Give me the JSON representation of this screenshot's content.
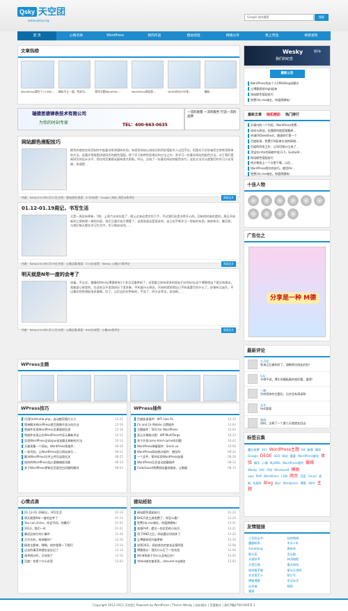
{
  "site": {
    "logo_a": "Qsky",
    "logo_b": "天空团",
    "url": "www.qsky.org"
  },
  "search": {
    "placeholder": "Google 站内搜索",
    "button": "搜索"
  },
  "nav": [
    "首 页",
    "心情点滴",
    "WordPress",
    "我的作品",
    "建站经验",
    "网络分享",
    "我上传品",
    "探索发现"
  ],
  "hot": {
    "title": "文章热榜",
    "items": [
      "WordPress简约个人CMS/...",
      "精彩不止一面，色彩为...",
      "简约主题WordPres...",
      "WordPress网站首...",
      "DEDE的SEO分享...",
      "最新...",
      "反对30天，只做...",
      "WordPress采集..."
    ]
  },
  "ad_top": {
    "company": "瑞德思德律表技术有限公司",
    "slogan": "为你的时刻专家",
    "phone": "TEL：400-663-0635",
    "right": "一流的质量 一流的服务 打造一流的品牌"
  },
  "posts": [
    {
      "title": "网站颜色搭配技巧",
      "text": "颜色的使用在网页制作中起着非常关键的作用，有很多网站以其成功的色彩搭配令人过目不忘。但是对于初学者而言常常用简单的方法，这篇文章就是讲述网页的颜色搭配。除了学习各种色彩理论和方法之外，多学习一些著名网站的配色方法，对于我们提高网页的设计水平，抓住网页美感无疑有很大帮助。所以，总结了一些著名网站的配色技巧，这些方法可以使我们的学习少走弯路，快速提...",
      "meta": "作者：Tokky/2013年1月22日/分类：建站经验/阅读：47次/标签：Google, 网站, 网页/6条评论",
      "more": "阅读全文"
    },
    {
      "title": "01.12-01.19周记，书写生活",
      "text": "又是一周没有更新，Y朋，上周六去年吃饭了，晚上过来还是交到下手，不过我们还是非常开心的。回来的时候也是的，周日开始新的三周和第一周的内容，然后又要开始写博客了，这周里面还是挺多的，自己也不断学习一些新的东西，新的知识，最后呢，与我们每天都在学习生活中，学习和成长吧。...",
      "meta": "作者：Tokky/2013年1月19日/分类：心情点滴/阅读：215次/标签：Wesky, 心情/37条评论",
      "more": "阅读全文"
    },
    {
      "title": "明天就是N年一度的会考了",
      "text": "听着，不过这，慢慢的Wesky博客就有1个多月没看更新了，还是跟之前有很多的朋友们对Wesky这个博客提出了意见和建议，我都虚心接受的，在这些日子里我经历了很多事，不知道什么原因，开始的就觉得自己不知道要写些什么了，好像有点迷茫。不过最近经常想起很多事情，好了，以后会好好更新的，不说了，明天去考试，加油吧。...",
      "meta": "作者：Tokky/2013年1月11日/分类：心情点滴/阅读：690次/标签：心情/84条评论",
      "more": "阅读全文"
    }
  ],
  "wp_themes": {
    "title": "WPress主题"
  },
  "wp_tips": {
    "title": "WPress技巧",
    "items": [
      [
        "巧用timthumb.php，自动裁剪图片大小",
        "12-21"
      ],
      [
        "简单解决WordPress首页图像不显示的方法",
        "12-19"
      ],
      [
        "免插件实现WordPress文章版权信息",
        "12-16"
      ],
      [
        "免插件实现让在WordPress中显示最新评论",
        "12-15"
      ],
      [
        "实现WordPress全站ajax化加载无刷新的方法",
        "10-14"
      ],
      [
        "又被采集一个网站，WordPress免插件...",
        "09-29"
      ],
      [
        "一条代码，让WordPress显示网站执行...",
        "09-22"
      ],
      [
        "解决WordPress文件上传后出现红叉",
        "08-25"
      ],
      [
        "给你的WordPress加入图像缩放功能",
        "08-14"
      ],
      [
        "关于WordPress更新后页面空白问题的解决",
        "08-03"
      ]
    ]
  },
  "wp_plugins": {
    "title": "WPress插件",
    "items": [
      [
        "百度收录插件：WTI Like Po",
        "12-10"
      ],
      [
        "Ck and Ck Mobile 点赞插件",
        "12-04"
      ],
      [
        "主题插件：SEO for WordPress",
        "12-02"
      ],
      [
        "显示文章统计图：WP-MultiTarge",
        "10-23"
      ],
      [
        "关于开发ckms-html-cache的问题",
        "10-02"
      ],
      [
        "WordPress弹窗插件：Smile vo",
        "10-06"
      ],
      [
        "WordPress网站统计插件：使用AI",
        "09-24"
      ],
      [
        "一个文件，帮你实现WordPress加速",
        "08-26"
      ],
      [
        "WordPress后台自动加载插件",
        "08-12"
      ],
      [
        "CodeGuard免费网站备份服务，让数据",
        "08-15"
      ]
    ]
  },
  "mood": {
    "title": "心情点滴",
    "items": [
      [
        "01.12-01.19周记，书写生活",
        "01-19"
      ],
      [
        "明天就是N年一度的会考了",
        "01-11"
      ],
      [
        "You can shine，你会不同，你最行！",
        "01-03"
      ],
      [
        "2013，我们一年",
        "01-01"
      ],
      [
        "最近比较忙的小事件",
        "12-26"
      ],
      [
        "大冷天的，有穿暖吗？",
        "12-26"
      ],
      [
        "搞到主题单，嘿嘿，给你我第一下我们",
        "12-14"
      ],
      [
        "过去的事怎样就应该忘记了",
        "12-10"
      ],
      [
        "高考倒计时，又快到了",
        "12-10"
      ],
      [
        "百度！你是个什么东西",
        "12-03"
      ]
    ]
  },
  "build": {
    "title": "建站经验",
    "items": [
      [
        "网站颜色搭配技巧",
        "01-22"
      ],
      [
        "BAE开发工具免费了，你怎么看？",
        "12-26"
      ],
      [
        "免费1年.me域名，你值得拥有！",
        "12-31"
      ],
      [
        "本地PHP，提交一些实用的小技巧",
        "12-21"
      ],
      [
        "用了DNZ之后，网站要访问快多了",
        "12-20"
      ],
      [
        "让博客体验升级更新",
        "12-16"
      ],
      [
        "说到30天，网站排名的变化还挺明显",
        "12-08"
      ],
      [
        "博客统计：我为什么打了一些东西",
        "12-06"
      ],
      [
        "Win8系统下为什么没有后台？",
        "12-05"
      ],
      [
        "Yahoo域名被发现，cdnunet.org域名",
        "12-02"
      ]
    ]
  },
  "side": {
    "banner_a": "Wesky",
    "banner_b": "我们的纪念",
    "banner_c": "第2年",
    "notice_title": "最新公告",
    "notice": [
      "WordPress色彩个人CMS/Blog双模式",
      "让博客感觉High起来",
      "网站颜色搭配技巧",
      "免费1年.me域名，你值得拥有！"
    ],
    "tabs": [
      "最新文章",
      "随机精彩",
      "热门排行"
    ],
    "articles": [
      "文章内的一个代码，WordPress免费...",
      "如何与原创，也懂得你图是我都原...",
      "申请00Dwebhost，邀请你们第一个",
      "百度收录，免费150起来交流的网络...",
      "百度的同系工作：让SEO统计工具了...",
      "湾宝在info(的网络中发)3.5，Godadd...",
      "网站颜色搭配技巧",
      "给文章加上一个分割下载，以后...",
      "WordPress简约的技巧，使用AIc...",
      "免费1年.me域名，你值得拥有！"
    ],
    "people_title": "十佳人物",
    "ad_title": "广告位之",
    "ad_text": "分享是一种 M德",
    "comments_title": "最新评论",
    "comments": [
      [
        "九月初",
        "秋来之后做的好了，请教两位网友好些！"
      ],
      [
        "lulu",
        "不得不说，博主的模板真的很好看，值得！"
      ],
      [
        "一路",
        "为何用你的主题后，后台没有再读取"
      ],
      [
        "无名",
        "test管理"
      ],
      [
        "海阔",
        "同时，注释了一个第二天就就在回去"
      ]
    ],
    "tags_title": "标签云集",
    "tags": [
      "魔方效果",
      "301",
      "WordPress主题",
      "B4",
      "美食",
      "精彩",
      "Google",
      "DEDE",
      "SEO",
      "网站",
      "重要",
      "WordPress美化",
      "体验",
      "精华",
      "心情",
      "MyDNS",
      "WordPress插件",
      "蜘蛛",
      "Wesky",
      "DIV",
      "代码",
      "Windows8",
      "模板",
      "ajax",
      "PHP",
      "WordPress",
      "CDN",
      "网页",
      "百度",
      "Gmail",
      "清新",
      "无插件",
      "Blog",
      "统计",
      "Wordpress",
      "博客",
      "AJAX",
      "主题"
    ],
    "links_title": "友情链接",
    "links": [
      "小百科全书",
      "钻的两侧",
      "魔都联系",
      "木头+木",
      "Ashelblog",
      "周有幸",
      "影分享",
      "怎么都",
      "天域技术",
      "林湾电影",
      "天视互联",
      "秦文网站",
      "饭局看不够",
      "星光天堂网",
      "文艺爱生人",
      "帕小号",
      "博客博客",
      "岁月年华",
      "自学者",
      "朝阳",
      "墨客"
    ]
  },
  "footer": "Copyright 2012-2013 天空团 | Powered by WordPress | Theme Wesky | 站长统计 | 百度统计 | 浙ICP备07001945号-1"
}
